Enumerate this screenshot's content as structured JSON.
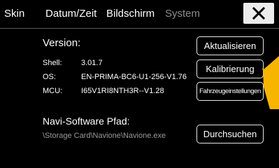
{
  "tabs": [
    {
      "label": "Skin",
      "active": true
    },
    {
      "label": "Datum/Zeit",
      "active": true
    },
    {
      "label": "Bildschirm",
      "active": true
    },
    {
      "label": "System",
      "active": false
    }
  ],
  "close_icon": "close-x-icon",
  "version": {
    "title": "Version:",
    "shell_label": "Shell:",
    "shell_value": "3.01.7",
    "os_label": "OS:",
    "os_value": "EN-PRIMA-BC6-U1-256-V1.76",
    "mcu_label": "MCU:",
    "mcu_value": "I65V1RI8NTH3R--V1.28"
  },
  "navi": {
    "title": "Navi-Software Pfad:",
    "path": "\\Storage Card\\Navione\\Navione.exe"
  },
  "buttons": {
    "aktualisieren": "Aktualisieren",
    "kalibrierung": "Kalibrierung",
    "fahrzeug": "Fahrzeugeinstellungen",
    "durchsuchen": "Durchsuchen"
  },
  "colors": {
    "background": "#000000",
    "text": "#ffffff",
    "inactive_tab": "#8c8c8c",
    "path_text": "#9a9a9a",
    "arrow": "#f7b500"
  }
}
